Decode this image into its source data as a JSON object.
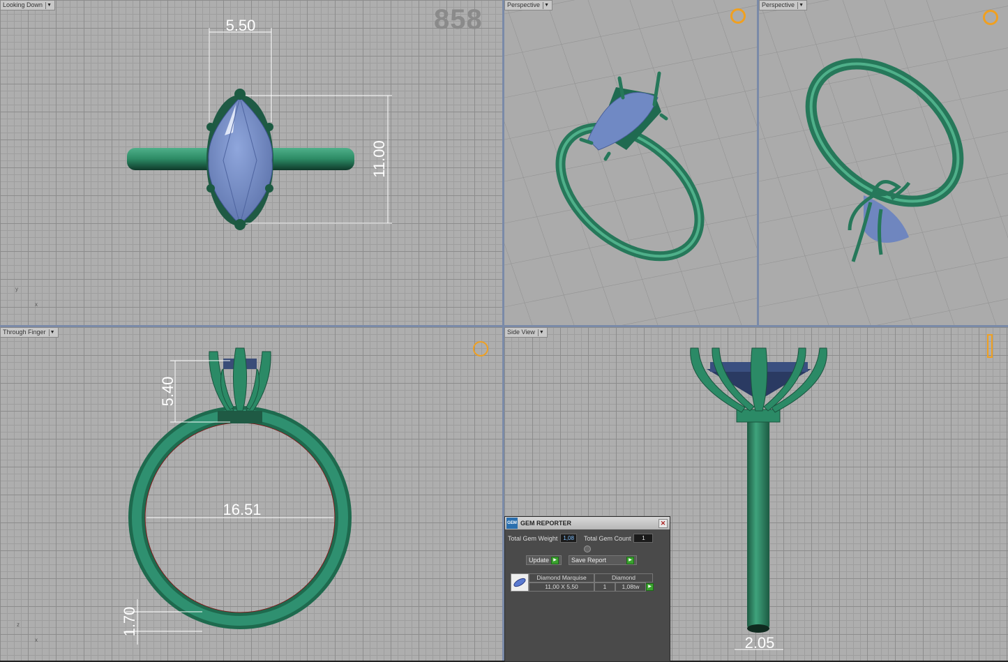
{
  "viewports": {
    "top_left": {
      "label": "Looking Down",
      "watermark": "858",
      "dim_width": "5.50",
      "dim_height": "11.00",
      "axis_y": "y",
      "axis_x": "x"
    },
    "top_mid": {
      "label": "Perspective"
    },
    "top_right": {
      "label": "Perspective"
    },
    "bottom_left": {
      "label": "Through Finger",
      "dim_head": "5.40",
      "dim_inner": "16.51",
      "dim_band": "1.70",
      "axis_z": "z",
      "axis_x": "x"
    },
    "bottom_right": {
      "label": "Side View",
      "dim_width": "2.05"
    }
  },
  "gem_reporter": {
    "title": "GEM REPORTER",
    "logo": "GEM",
    "close": "✕",
    "total_weight_label": "Total Gem Weight",
    "total_weight_value": "1,08",
    "total_count_label": "Total Gem Count",
    "total_count_value": "1",
    "update_label": "Update",
    "save_report_label": "Save Report",
    "row": {
      "name": "Diamond Marquise",
      "material": "Diamond",
      "size": "11,00 X 5,50",
      "count": "1",
      "weight": "1,08tw"
    }
  },
  "colors": {
    "metal": "#2e8a66",
    "gem": "#6f86bf",
    "grid_bg": "#aeaeae"
  }
}
